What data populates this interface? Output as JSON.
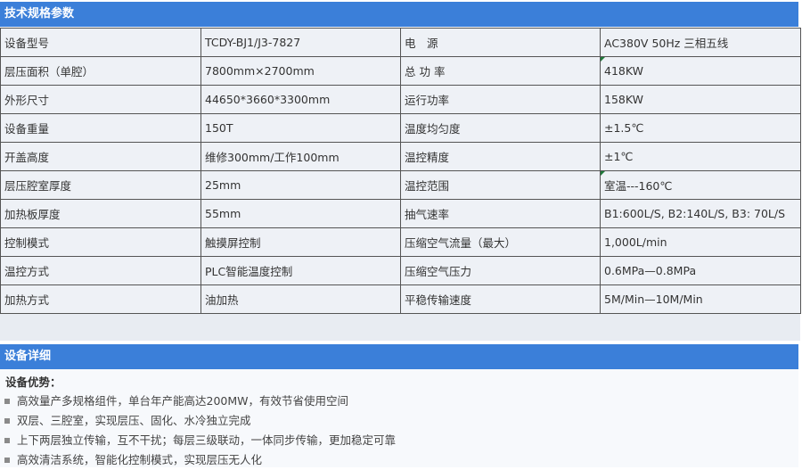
{
  "spec_section": {
    "title": "技术规格参数",
    "rows": [
      [
        "设备型号",
        "TCDY-BJ1/J3-7827",
        "电　源",
        "AC380V 50Hz 三相五线"
      ],
      [
        "层压面积（单腔）",
        "7800mm×2700mm",
        "总 功 率",
        "418KW"
      ],
      [
        "外形尺寸",
        "44650*3660*3300mm",
        "运行功率",
        "158KW"
      ],
      [
        "设备重量",
        "150T",
        "温度均匀度",
        "±1.5℃"
      ],
      [
        "开盖高度",
        "维修300mm/工作100mm",
        "温控精度",
        "±1℃"
      ],
      [
        "层压腔室厚度",
        "25mm",
        "温控范围",
        "室温---160℃"
      ],
      [
        "加热板厚度",
        "55mm",
        "抽气速率",
        "B1:600L/S, B2:140L/S, B3: 70L/S"
      ],
      [
        "控制模式",
        "触摸屏控制",
        "压缩空气流量（最大）",
        "1,000L/min"
      ],
      [
        "温控方式",
        "PLC智能温度控制",
        "压缩空气压力",
        "0.6MPa—0.8MPa"
      ],
      [
        "加热方式",
        "油加热",
        "平稳传输速度",
        "5M/Min—10M/Min"
      ]
    ]
  },
  "detail_section": {
    "title": "设备详细",
    "advantages_title": "设备优势：",
    "advantages": [
      "高效量产多规格组件，单台年产能高达200MW，有效节省使用空间",
      "双层、三腔室，实现层压、固化、水冷独立完成",
      "上下两层独立传输，互不干扰；每层三级联动，一体同步传输，更加稳定可靠",
      "高效清洁系统，智能化控制模式，实现层压无人化"
    ]
  },
  "colors": {
    "header_bg": "#3b7fd9",
    "cell_bg": "#eef1f6",
    "border": "#555555"
  }
}
